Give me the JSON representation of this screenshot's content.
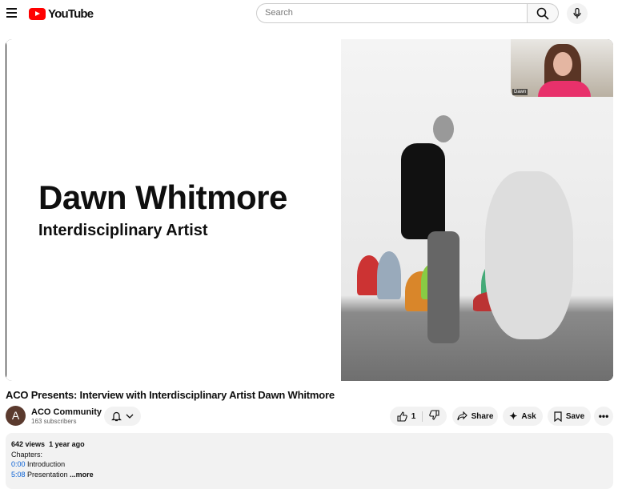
{
  "header": {
    "logo_text": "YouTube",
    "search_placeholder": "Search"
  },
  "video": {
    "slide_name": "Dawn Whitmore",
    "slide_subtitle": "Interdisciplinary Artist",
    "webcam_label": "Dawn"
  },
  "title": "ACO Presents: Interview with Interdisciplinary Artist Dawn Whitmore",
  "channel": {
    "avatar_letter": "A",
    "name": "ACO Community",
    "subscribers": "163 subscribers"
  },
  "actions": {
    "likes": "1",
    "share": "Share",
    "ask": "Ask",
    "save": "Save"
  },
  "description": {
    "views": "642 views",
    "age": "1 year ago",
    "chapters_label": "Chapters:",
    "chapters": [
      {
        "time": "0:00",
        "title": "Introduction"
      },
      {
        "time": "5:08",
        "title": "Presentation"
      }
    ],
    "more": "...more"
  }
}
